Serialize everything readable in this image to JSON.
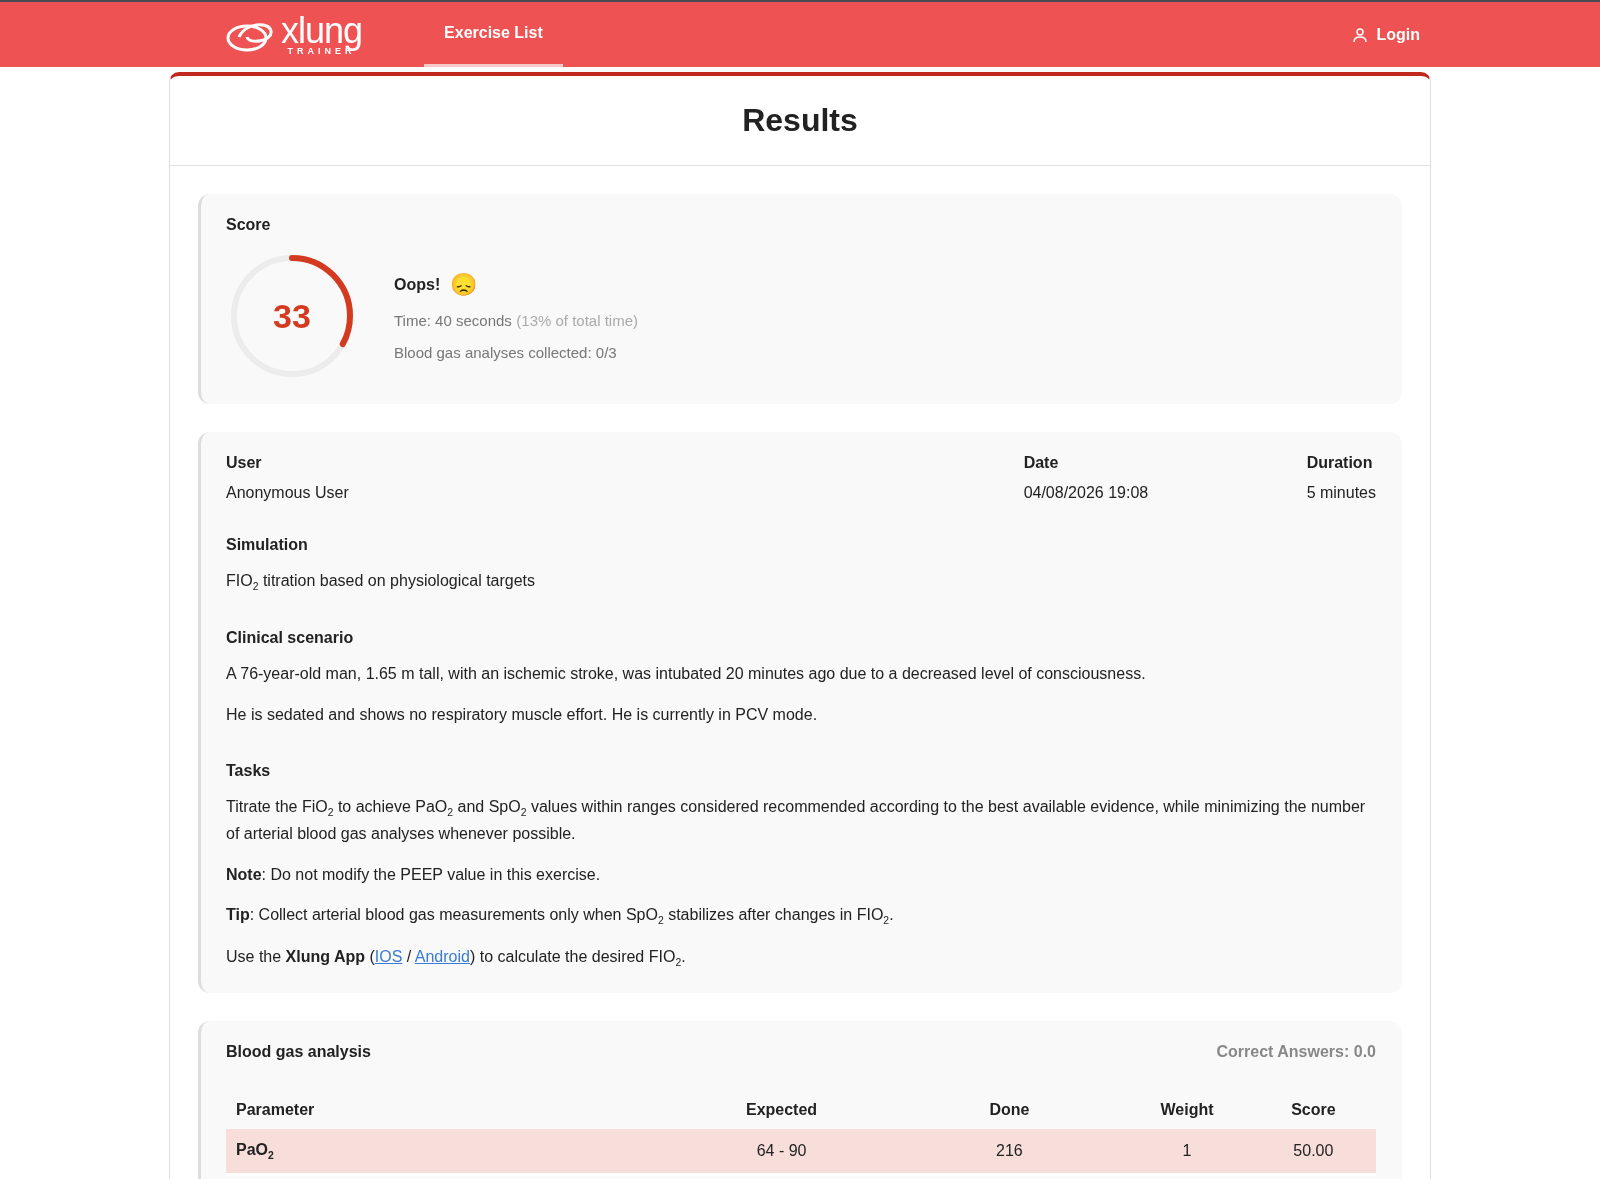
{
  "header": {
    "logo": {
      "name": "xlung",
      "subtitle": "TRAINER"
    },
    "nav": [
      {
        "label": "Exercise List",
        "selected": true
      }
    ],
    "login": "Login"
  },
  "title": "Results",
  "score": {
    "heading": "Score",
    "value": "33",
    "level": 0.33,
    "headline": "Oops!",
    "emoji": "😞",
    "time": "Time: 40 seconds",
    "time_share": "(13% of total time)",
    "collected": "Blood gas analyses collected: 0/3"
  },
  "info": {
    "fields": [
      {
        "label": "User",
        "value": "Anonymous User"
      },
      {
        "label": "Date",
        "value": "04/08/2026 19:08"
      },
      {
        "label": "Duration",
        "value": "5 minutes"
      }
    ],
    "sections": [
      {
        "heading": "Simulation",
        "paragraphs": [
          [
            {
              "kind": "text",
              "text": "FIO$_{2}$ titration based on physiological targets"
            }
          ]
        ]
      },
      {
        "heading": "Clinical scenario",
        "paragraphs": [
          [
            {
              "kind": "text",
              "text": "A 76-year-old man, 1.65 m tall, with an ischemic stroke, was intubated 20 minutes ago due to a decreased level of consciousness."
            }
          ],
          [
            {
              "kind": "text",
              "text": "He is sedated and shows no respiratory muscle effort. He is currently in PCV mode."
            }
          ]
        ]
      },
      {
        "heading": "Tasks",
        "paragraphs": [
          [
            {
              "kind": "text",
              "text": "Titrate the FiO$_{2}$ to achieve PaO$_{2}$ and SpO$_{2}$ values within ranges considered recommended according to the best available evidence, while minimizing the number of arterial blood gas analyses whenever possible."
            }
          ],
          [
            {
              "kind": "text",
              "text": "**Note**: Do not modify the PEEP value in this exercise."
            }
          ],
          [
            {
              "kind": "text",
              "text": "**Tip**: Collect arterial blood gas measurements only when SpO$_{2}$ stabilizes after changes in FIO$_{2}$."
            }
          ],
          [
            {
              "kind": "text",
              "text": "Use the **Xlung App** ("
            },
            {
              "kind": "link",
              "text": "IOS"
            },
            {
              "kind": "text",
              "text": " / "
            },
            {
              "kind": "link",
              "text": "Android"
            },
            {
              "kind": "text",
              "text": ") to calculate the desired FIO$_{2}$."
            }
          ]
        ]
      }
    ]
  },
  "blood_gas": {
    "heading": "Blood gas analysis",
    "correct_answers": "Correct Answers: 0.0",
    "columns": [
      "Parameter",
      "Expected",
      "Done",
      "Weight",
      "Score"
    ],
    "rows": [
      {
        "cells": [
          "PaO$_{2}$",
          "64 - 90",
          "216",
          "1",
          "50.00"
        ],
        "correct": false
      }
    ]
  }
}
